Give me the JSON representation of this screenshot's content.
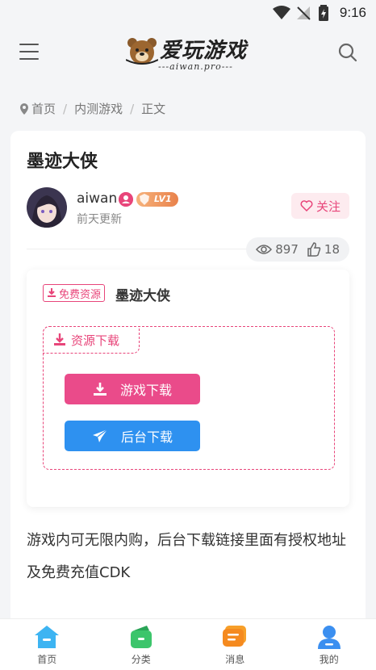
{
  "status_bar": {
    "time": "9:16"
  },
  "header": {
    "logo_title": "爱玩游戏",
    "logo_subtitle": "---aiwan.pro---",
    "menu_icon": "menu-icon",
    "search_icon": "search-icon"
  },
  "breadcrumb": [
    "首页",
    "内测游戏",
    "正文"
  ],
  "post": {
    "title": "墨迹大侠",
    "author": "aiwan",
    "level": "LV1",
    "time": "前天更新",
    "follow_label": "关注",
    "views": "897",
    "likes": "18"
  },
  "download": {
    "tag": "免费资源",
    "name": "墨迹大侠",
    "box_label": "资源下载",
    "game_button": "游戏下载",
    "backend_button": "后台下载"
  },
  "description": "游戏内可无限内购，后台下载链接里面有授权地址及免费充值CDK",
  "tabbar": [
    {
      "label": "首页",
      "icon": "home-icon"
    },
    {
      "label": "分类",
      "icon": "category-icon"
    },
    {
      "label": "消息",
      "icon": "message-icon"
    },
    {
      "label": "我的",
      "icon": "profile-icon"
    }
  ],
  "colors": {
    "accent": "#e8457a",
    "blue": "#2e91f0"
  }
}
